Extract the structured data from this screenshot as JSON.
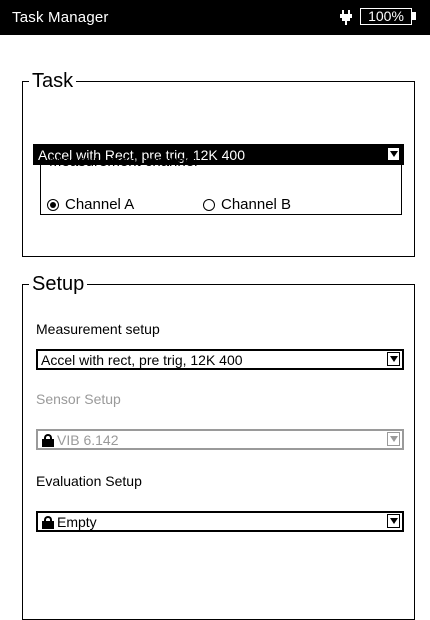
{
  "titlebar": {
    "title": "Task Manager",
    "battery": "100%",
    "power_icon": "plug-icon"
  },
  "task": {
    "legend": "Task",
    "selected_task": "Accel with Rect, pre trig, 12K 400",
    "measurement_channel": {
      "legend": "Measurement channel",
      "options": [
        {
          "label": "Channel A",
          "selected": true
        },
        {
          "label": "Channel B",
          "selected": false
        }
      ]
    }
  },
  "setup": {
    "legend": "Setup",
    "measurement_setup": {
      "label": "Measurement setup",
      "value": "Accel with rect, pre trig, 12K 400"
    },
    "sensor_setup": {
      "label": "Sensor Setup",
      "value": "VIB 6.142",
      "disabled": true,
      "locked": true
    },
    "evaluation_setup": {
      "label": "Evaluation Setup",
      "value": "Empty",
      "locked": true
    }
  },
  "colors": {
    "titlebar_bg": "#000000",
    "disabled_text": "#9a9a9a"
  }
}
